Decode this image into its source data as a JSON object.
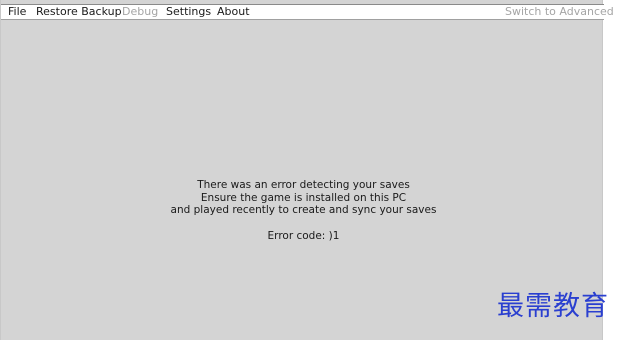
{
  "menubar": {
    "file": "File",
    "restore_backup": "Restore Backup",
    "debug": "Debug",
    "settings": "Settings",
    "about": "About",
    "switch_advanced": "Switch to Advanced"
  },
  "message": {
    "line1": "There was an error detecting your saves",
    "line2": "Ensure the game is installed on this PC",
    "line3": "and played recently to create and sync your saves",
    "error_code": "Error code: )1"
  },
  "watermark": {
    "text": "最需教育",
    "color": "#2a3fd0"
  },
  "colors": {
    "background": "#d4d4d4",
    "menubar": "#ffffff",
    "disabled_text": "#a5a5a5"
  }
}
